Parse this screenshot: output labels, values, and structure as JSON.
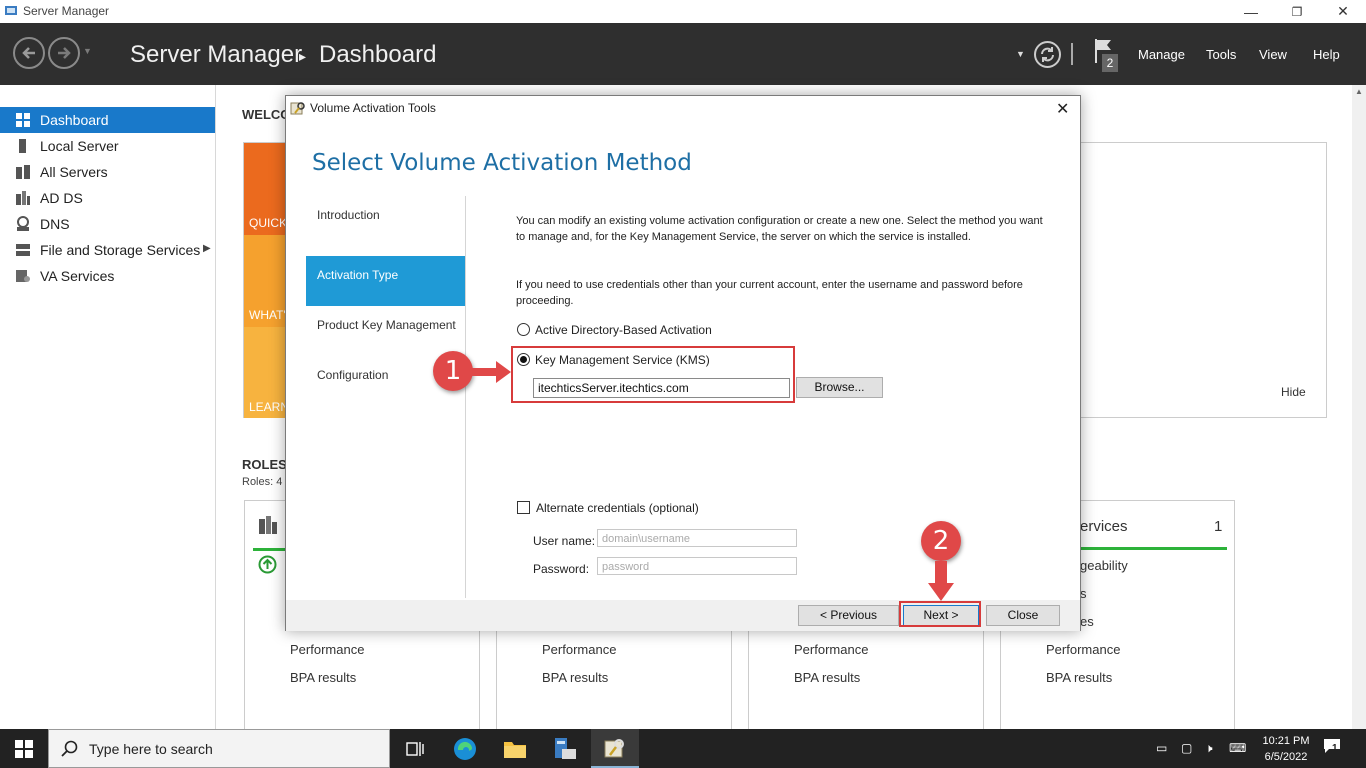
{
  "window": {
    "title": "Server Manager",
    "minimize": "—",
    "restore": "❐",
    "close": "✕"
  },
  "header": {
    "app": "Server Manager",
    "separator": "▸",
    "page": "Dashboard",
    "flag_count": "2",
    "menus": [
      "Manage",
      "Tools",
      "View",
      "Help"
    ]
  },
  "sidebar": {
    "items": [
      {
        "label": "Dashboard",
        "icon": "dashboard-icon"
      },
      {
        "label": "Local Server",
        "icon": "server-icon"
      },
      {
        "label": "All Servers",
        "icon": "servers-icon"
      },
      {
        "label": "AD DS",
        "icon": "ad-icon"
      },
      {
        "label": "DNS",
        "icon": "dns-icon"
      },
      {
        "label": "File and Storage Services",
        "icon": "storage-icon"
      },
      {
        "label": "VA Services",
        "icon": "va-icon"
      }
    ]
  },
  "main": {
    "welcome_title": "WELCO",
    "tiles": [
      "QUICK",
      "WHAT'",
      "LEARN"
    ],
    "hide": "Hide",
    "roles_title": "ROLES",
    "roles_sub": "Roles: 4",
    "card_services_title": "ervices",
    "card_services_count": "1",
    "card_partial": [
      "geability",
      "s",
      "es"
    ],
    "card_rows": [
      "Performance",
      "BPA results"
    ]
  },
  "dialog": {
    "title": "Volume Activation Tools",
    "heading": "Select Volume Activation Method",
    "steps": [
      "Introduction",
      "Activation Type",
      "Product Key Management",
      "Configuration"
    ],
    "para1": "You can modify an existing volume activation configuration or create a new one. Select the method you want to manage and, for the Key Management Service, the server on which the service is installed.",
    "para2": "If you need to use credentials other than your current account, enter the username and password before proceeding.",
    "option_ad": "Active Directory-Based Activation",
    "option_kms": "Key Management Service (KMS)",
    "server_value": "itechticsServer.itechtics.com",
    "browse": "Browse...",
    "alt_credentials": "Alternate credentials (optional)",
    "username_label": "User name:",
    "username_placeholder": "domain\\username",
    "password_label": "Password:",
    "password_placeholder": "password",
    "previous": "< Previous",
    "next": "Next >",
    "close": "Close"
  },
  "annotations": {
    "badge1": "1",
    "badge2": "2",
    "highlight_color": "#d73b3b"
  },
  "taskbar": {
    "search_placeholder": "Type here to search",
    "time": "10:21 PM",
    "date": "6/5/2022",
    "notification_count": "1"
  }
}
